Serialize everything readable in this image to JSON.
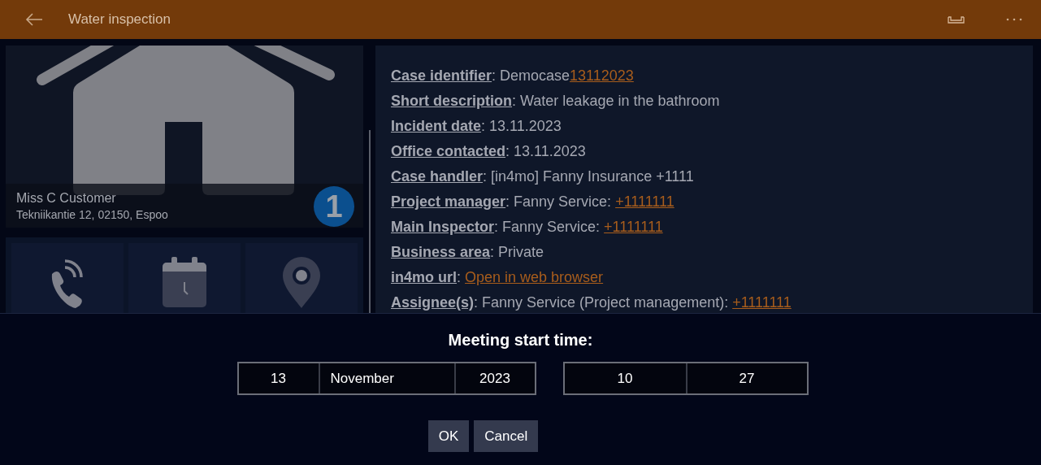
{
  "window": {
    "title": "Water inspection"
  },
  "customer": {
    "name": "Miss C Customer",
    "address": "Tekniikantie 12, 02150, Espoo",
    "badge": "1"
  },
  "details": [
    {
      "label": "Case identifier",
      "value": ": Democase",
      "link": "13112023"
    },
    {
      "label": "Short description",
      "value": ": Water leakage in the bathroom"
    },
    {
      "label": "Incident date",
      "value": ": 13.11.2023"
    },
    {
      "label": "Office contacted",
      "value": ": 13.11.2023"
    },
    {
      "label": "Case handler",
      "value": ": [in4mo] Fanny Insurance +1111"
    },
    {
      "label": "Project manager",
      "value": ": Fanny Service: ",
      "link": "+1111111"
    },
    {
      "label": "Main Inspector",
      "value": ": Fanny Service: ",
      "link": "+1111111"
    },
    {
      "label": "Business area",
      "value": ": Private"
    },
    {
      "label": "in4mo url",
      "value": ": ",
      "link": "Open in web browser"
    },
    {
      "label": "Assignee(s)",
      "value": ": Fanny Service (Project management): ",
      "link": "+1111111"
    }
  ],
  "dialog": {
    "title": "Meeting start time:",
    "date": {
      "day": "13",
      "month": "November",
      "year": "2023"
    },
    "time": {
      "hour": "10",
      "minute": "27"
    },
    "buttons": [
      "OK",
      "Cancel"
    ]
  }
}
